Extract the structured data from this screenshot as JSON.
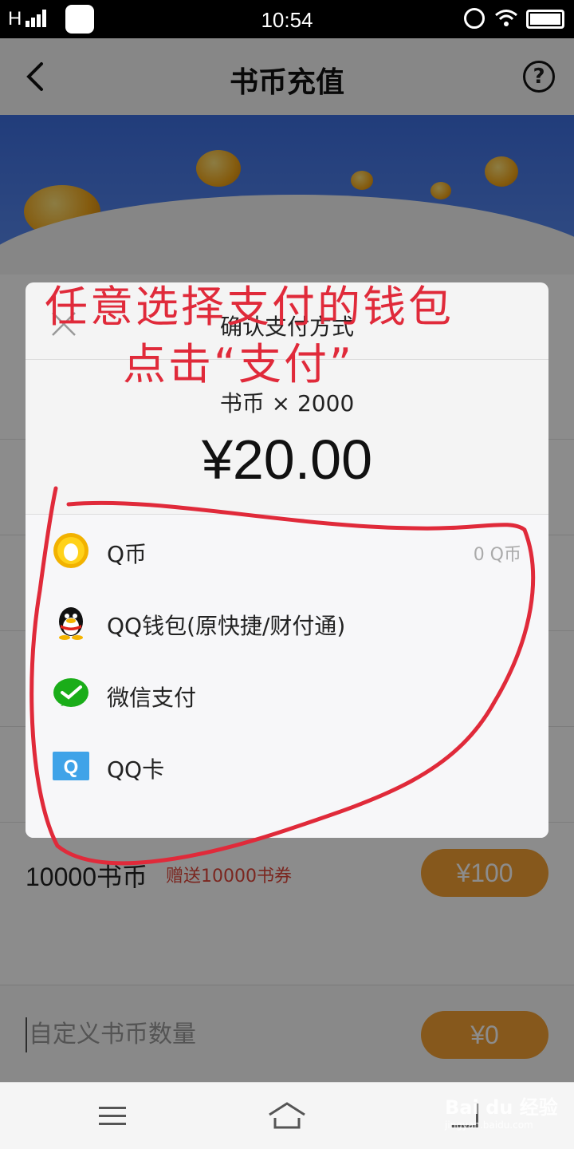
{
  "status_bar": {
    "network": "H",
    "time": "10:54"
  },
  "header": {
    "title": "书币充值",
    "help_label": "?"
  },
  "list": {
    "last_item": {
      "coins": "10000书币",
      "gift": "赠送10000书券",
      "price": "¥100"
    }
  },
  "custom": {
    "placeholder": "自定义书币数量",
    "price": "¥0"
  },
  "modal": {
    "title": "确认支付方式",
    "quantity": "书币 × 2000",
    "amount": "¥20.00",
    "methods": [
      {
        "label": "Q币",
        "balance": "0 Q币",
        "icon": "qcoin-icon"
      },
      {
        "label": "QQ钱包(原快捷/财付通)",
        "icon": "qq-penguin-icon"
      },
      {
        "label": "微信支付",
        "icon": "wechat-pay-icon"
      },
      {
        "label": "QQ卡",
        "icon": "qq-card-icon"
      }
    ]
  },
  "annotation": {
    "line1": "任意选择支付的钱包",
    "line2": "点击“支付”"
  },
  "watermark": {
    "brand": "Bai du 经验",
    "url": "jingyan.baidu.com"
  },
  "colors": {
    "accent_orange": "#f5a033",
    "annotation_red": "#e02a3a",
    "gift_red": "#e0463a",
    "banner_blue": "#3d6fe0"
  }
}
